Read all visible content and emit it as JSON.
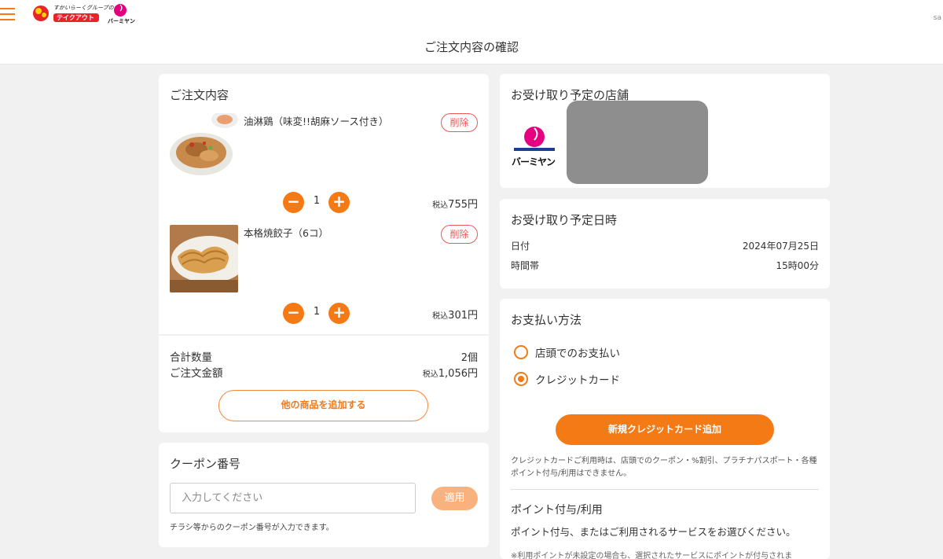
{
  "header": {
    "brand_top_text": "すかいらーくグループの",
    "brand_takeout": "テイクアウト",
    "brand2": "バーミヤン",
    "right_label": "sa",
    "page_title": "ご注文内容の確認"
  },
  "order": {
    "title": "ご注文内容",
    "items": [
      {
        "name": "油淋鶏（味変!!胡麻ソース付き）",
        "delete": "削除",
        "minus": "−",
        "qty": "1",
        "plus": "+",
        "tax_label": "税込",
        "price": "755円"
      },
      {
        "name": "本格焼餃子（6コ）",
        "delete": "削除",
        "minus": "−",
        "qty": "1",
        "plus": "+",
        "tax_label": "税込",
        "price": "301円"
      }
    ],
    "total_qty_label": "合計数量",
    "total_qty": "2個",
    "total_amount_label": "ご注文金額",
    "total_tax_label": "税込",
    "total_amount": "1,056円",
    "add_more": "他の商品を追加する"
  },
  "coupon": {
    "title": "クーポン番号",
    "placeholder": "入力してください",
    "apply": "適用",
    "note": "チラシ等からのクーポン番号が入力できます。"
  },
  "store": {
    "title": "お受け取り予定の店舗",
    "logo_text": "バーミヤン"
  },
  "pickup": {
    "title": "お受け取り予定日時",
    "date_label": "日付",
    "date": "2024年07月25日",
    "time_label": "時間帯",
    "time": "15時00分"
  },
  "payment": {
    "title": "お支払い方法",
    "options": [
      {
        "label": "店頭でのお支払い",
        "checked": false
      },
      {
        "label": "クレジットカード",
        "checked": true
      }
    ],
    "add_card": "新規クレジットカード追加",
    "card_note": "クレジットカードご利用時は、店頭でのクーポン・%割引、プラチナパスポート・各種ポイント付与/利用はできません。",
    "point_title": "ポイント付与/利用",
    "point_desc": "ポイント付与、またはご利用されるサービスをお選びください。",
    "point_note": "※利用ポイントが未設定の場合も、選択されたサービスにポイントが付与されま"
  },
  "colors": {
    "accent": "#f47a16",
    "delete_red": "#e85a5a",
    "apply_disabled": "#f9b27e",
    "background": "#f1f1f1"
  }
}
